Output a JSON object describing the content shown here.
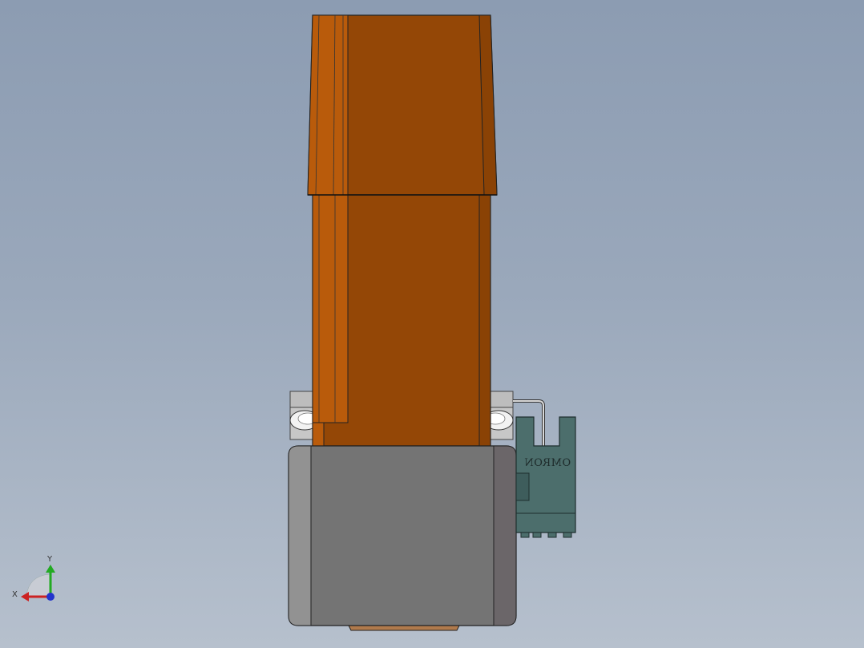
{
  "viewport": {
    "background_top": "#8c9cb2",
    "background_bottom": "#b6c0cd"
  },
  "model": {
    "sensor_brand": "OMRON",
    "colors": {
      "upper_housing": "#944706",
      "upper_housing_highlight": "#b95b0b",
      "motor_body": "#747474",
      "motor_side": "#929292",
      "motor_side_right": "#6b6669",
      "sensor_bracket": "#4c6e6c",
      "mounting_ring": "#c9c9c9"
    }
  },
  "triad": {
    "x_label": "X",
    "y_label": "Y",
    "x_color": "#cc2222",
    "y_color": "#22aa22",
    "z_color": "#2233cc"
  }
}
